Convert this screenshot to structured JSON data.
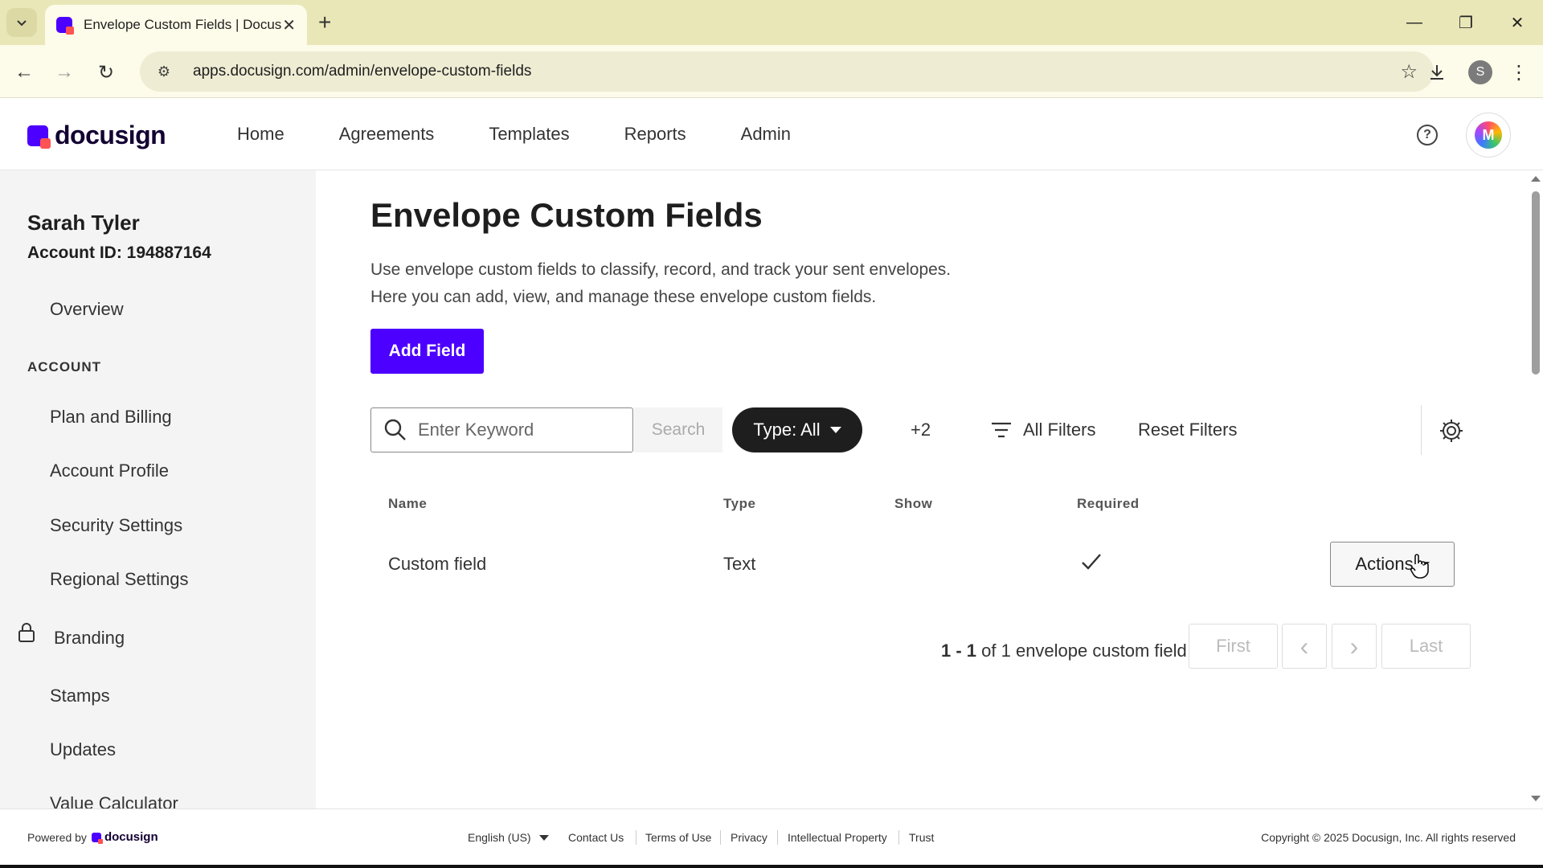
{
  "browser": {
    "tab_title": "Envelope Custom Fields | Docusign",
    "url": "apps.docusign.com/admin/envelope-custom-fields",
    "profile_initial": "S"
  },
  "header": {
    "brand": "docusign",
    "nav": [
      "Home",
      "Agreements",
      "Templates",
      "Reports",
      "Admin"
    ],
    "avatar_initial": "M"
  },
  "sidebar": {
    "user_name": "Sarah Tyler",
    "account_id": "Account ID: 194887164",
    "overview": "Overview",
    "section_account": "ACCOUNT",
    "items": [
      "Plan and Billing",
      "Account Profile",
      "Security Settings",
      "Regional Settings",
      "Branding",
      "Stamps",
      "Updates",
      "Value Calculator"
    ]
  },
  "main": {
    "title": "Envelope Custom Fields",
    "desc_line1": "Use envelope custom fields to classify, record, and track your sent envelopes.",
    "desc_line2": "Here you can add, view, and manage these envelope custom fields.",
    "add_field_label": "Add Field",
    "search_placeholder": "Enter Keyword",
    "search_label": "Search",
    "type_filter": "Type: All",
    "more_filters": "+2",
    "all_filters": "All Filters",
    "reset_filters": "Reset Filters",
    "columns": [
      "Name",
      "Type",
      "Show",
      "Required"
    ],
    "rows": [
      {
        "name": "Custom field",
        "type": "Text",
        "show": "",
        "required": true,
        "actions_label": "Actions"
      }
    ],
    "pager": {
      "range": "1 - 1",
      "summary": "of 1 envelope custom field",
      "first": "First",
      "prev": "‹",
      "next": "›",
      "last": "Last"
    }
  },
  "footer": {
    "powered_by": "Powered by",
    "brand": "docusign",
    "language": "English (US)",
    "links": [
      "Contact Us",
      "Terms of Use",
      "Privacy",
      "Intellectual Property",
      "Trust"
    ],
    "copyright": "Copyright © 2025 Docusign, Inc. All rights reserved"
  },
  "colors": {
    "accent": "#4c00ff",
    "brand_red": "#ff5252",
    "chrome": "#e9e7b8"
  }
}
